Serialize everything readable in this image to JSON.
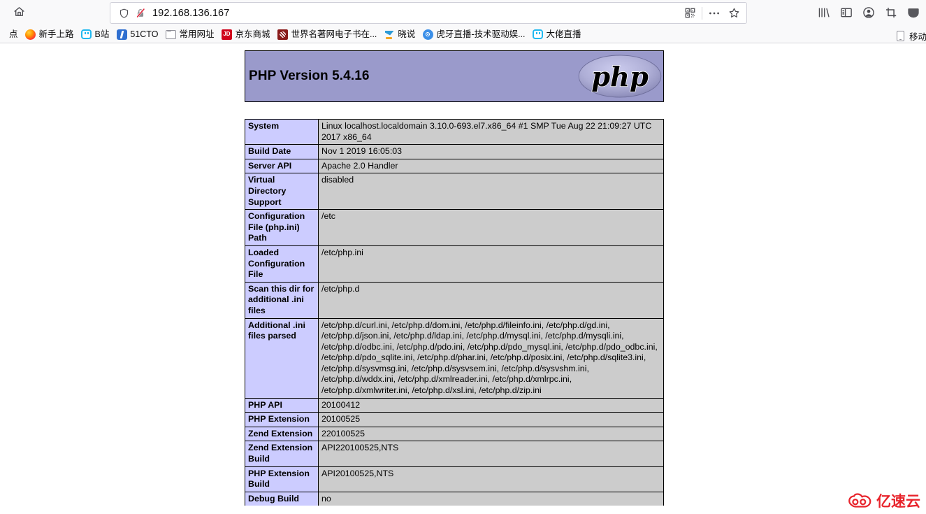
{
  "browser": {
    "home_icon": "home-icon",
    "address": {
      "shield_icon": "shield-icon",
      "insecure_icon": "lock-crossed-out-icon",
      "url": "192.168.136.167",
      "qr_icon": "qr-code-icon",
      "menu_icon": "three-dots-icon",
      "bookmark_icon": "star-icon"
    },
    "toolbar_icons": [
      {
        "name": "library-icon",
        "label": "Library"
      },
      {
        "name": "sidebar-icon",
        "label": "Sidebars"
      },
      {
        "name": "account-icon",
        "label": "Account"
      },
      {
        "name": "screenshot-icon",
        "label": "Screenshot"
      },
      {
        "name": "pocket-icon",
        "label": "Pocket"
      }
    ],
    "bookmarks": [
      {
        "label": "点",
        "icon": "clipped-bookmark-icon"
      },
      {
        "label": "新手上路",
        "icon": "firefox-icon"
      },
      {
        "label": "B站",
        "icon": "bilibili-icon"
      },
      {
        "label": "51CTO",
        "icon": "51cto-icon"
      },
      {
        "label": "常用网址",
        "icon": "folder-icon"
      },
      {
        "label": "京东商城",
        "icon": "jd-icon"
      },
      {
        "label": "世界名著网电子书在...",
        "icon": "book-site-icon"
      },
      {
        "label": "晓说",
        "icon": "xiaoshuo-icon"
      },
      {
        "label": "虎牙直播-技术驱动娱...",
        "icon": "huya-icon"
      },
      {
        "label": "大佬直播",
        "icon": "bilibili-icon"
      }
    ],
    "bookmark_right": {
      "label": "移动",
      "icon": "mobile-phone-icon"
    }
  },
  "phpinfo": {
    "banner": {
      "title": "PHP Version 5.4.16",
      "logo_text": "php",
      "bg_color": "#9a9acb"
    },
    "colors": {
      "key_cell": "#ccccff",
      "value_cell": "#cccccc",
      "border": "#000000"
    },
    "rows": [
      {
        "key": "System",
        "value": "Linux localhost.localdomain 3.10.0-693.el7.x86_64 #1 SMP Tue Aug 22 21:09:27 UTC 2017 x86_64"
      },
      {
        "key": "Build Date",
        "value": "Nov 1 2019 16:05:03"
      },
      {
        "key": "Server API",
        "value": "Apache 2.0 Handler"
      },
      {
        "key": "Virtual Directory Support",
        "value": "disabled"
      },
      {
        "key": "Configuration File (php.ini) Path",
        "value": "/etc"
      },
      {
        "key": "Loaded Configuration File",
        "value": "/etc/php.ini"
      },
      {
        "key": "Scan this dir for additional .ini files",
        "value": "/etc/php.d"
      },
      {
        "key": "Additional .ini files parsed",
        "value": "/etc/php.d/curl.ini, /etc/php.d/dom.ini, /etc/php.d/fileinfo.ini, /etc/php.d/gd.ini, /etc/php.d/json.ini, /etc/php.d/ldap.ini, /etc/php.d/mysql.ini, /etc/php.d/mysqli.ini, /etc/php.d/odbc.ini, /etc/php.d/pdo.ini, /etc/php.d/pdo_mysql.ini, /etc/php.d/pdo_odbc.ini, /etc/php.d/pdo_sqlite.ini, /etc/php.d/phar.ini, /etc/php.d/posix.ini, /etc/php.d/sqlite3.ini, /etc/php.d/sysvmsg.ini, /etc/php.d/sysvsem.ini, /etc/php.d/sysvshm.ini, /etc/php.d/wddx.ini, /etc/php.d/xmlreader.ini, /etc/php.d/xmlrpc.ini, /etc/php.d/xmlwriter.ini, /etc/php.d/xsl.ini, /etc/php.d/zip.ini"
      },
      {
        "key": "PHP API",
        "value": "20100412"
      },
      {
        "key": "PHP Extension",
        "value": "20100525"
      },
      {
        "key": "Zend Extension",
        "value": "220100525"
      },
      {
        "key": "Zend Extension Build",
        "value": "API220100525,NTS"
      },
      {
        "key": "PHP Extension Build",
        "value": "API20100525,NTS"
      },
      {
        "key": "Debug Build",
        "value": "no"
      }
    ]
  },
  "watermark": {
    "text": "亿速云",
    "color": "#e8242c",
    "icon": "cloud-logo-icon"
  }
}
